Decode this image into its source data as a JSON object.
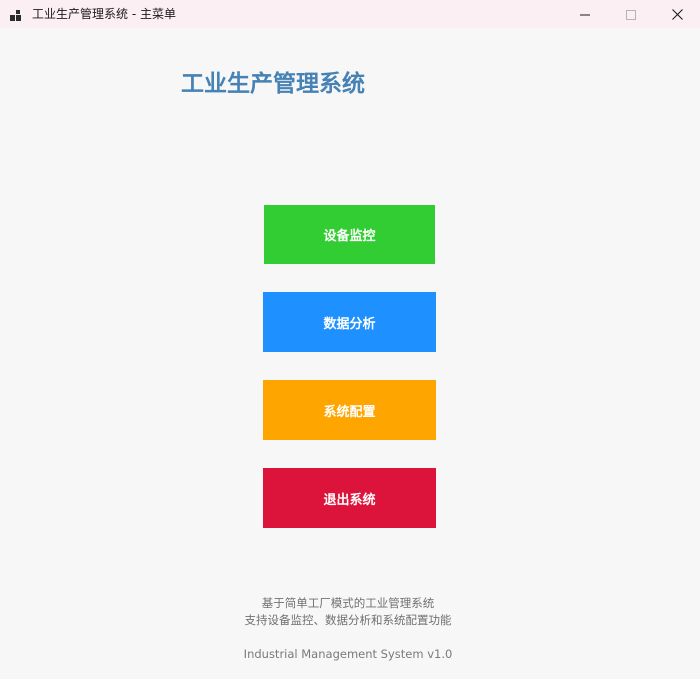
{
  "window": {
    "title": "工业生产管理系统 - 主菜单"
  },
  "header": {
    "title": "工业生产管理系统"
  },
  "menu": {
    "buttons": [
      {
        "label": "设备监控",
        "color": "#32cd32"
      },
      {
        "label": "数据分析",
        "color": "#1e90ff"
      },
      {
        "label": "系统配置",
        "color": "#ffa500"
      },
      {
        "label": "退出系统",
        "color": "#dc143c"
      }
    ]
  },
  "footer": {
    "description_line1": "基于简单工厂模式的工业管理系统",
    "description_line2": "支持设备监控、数据分析和系统配置功能",
    "version": "Industrial Management System v1.0"
  },
  "icons": {
    "app": "app-grid-icon",
    "minimize": "minimize-icon",
    "maximize": "maximize-icon",
    "close": "close-icon"
  }
}
